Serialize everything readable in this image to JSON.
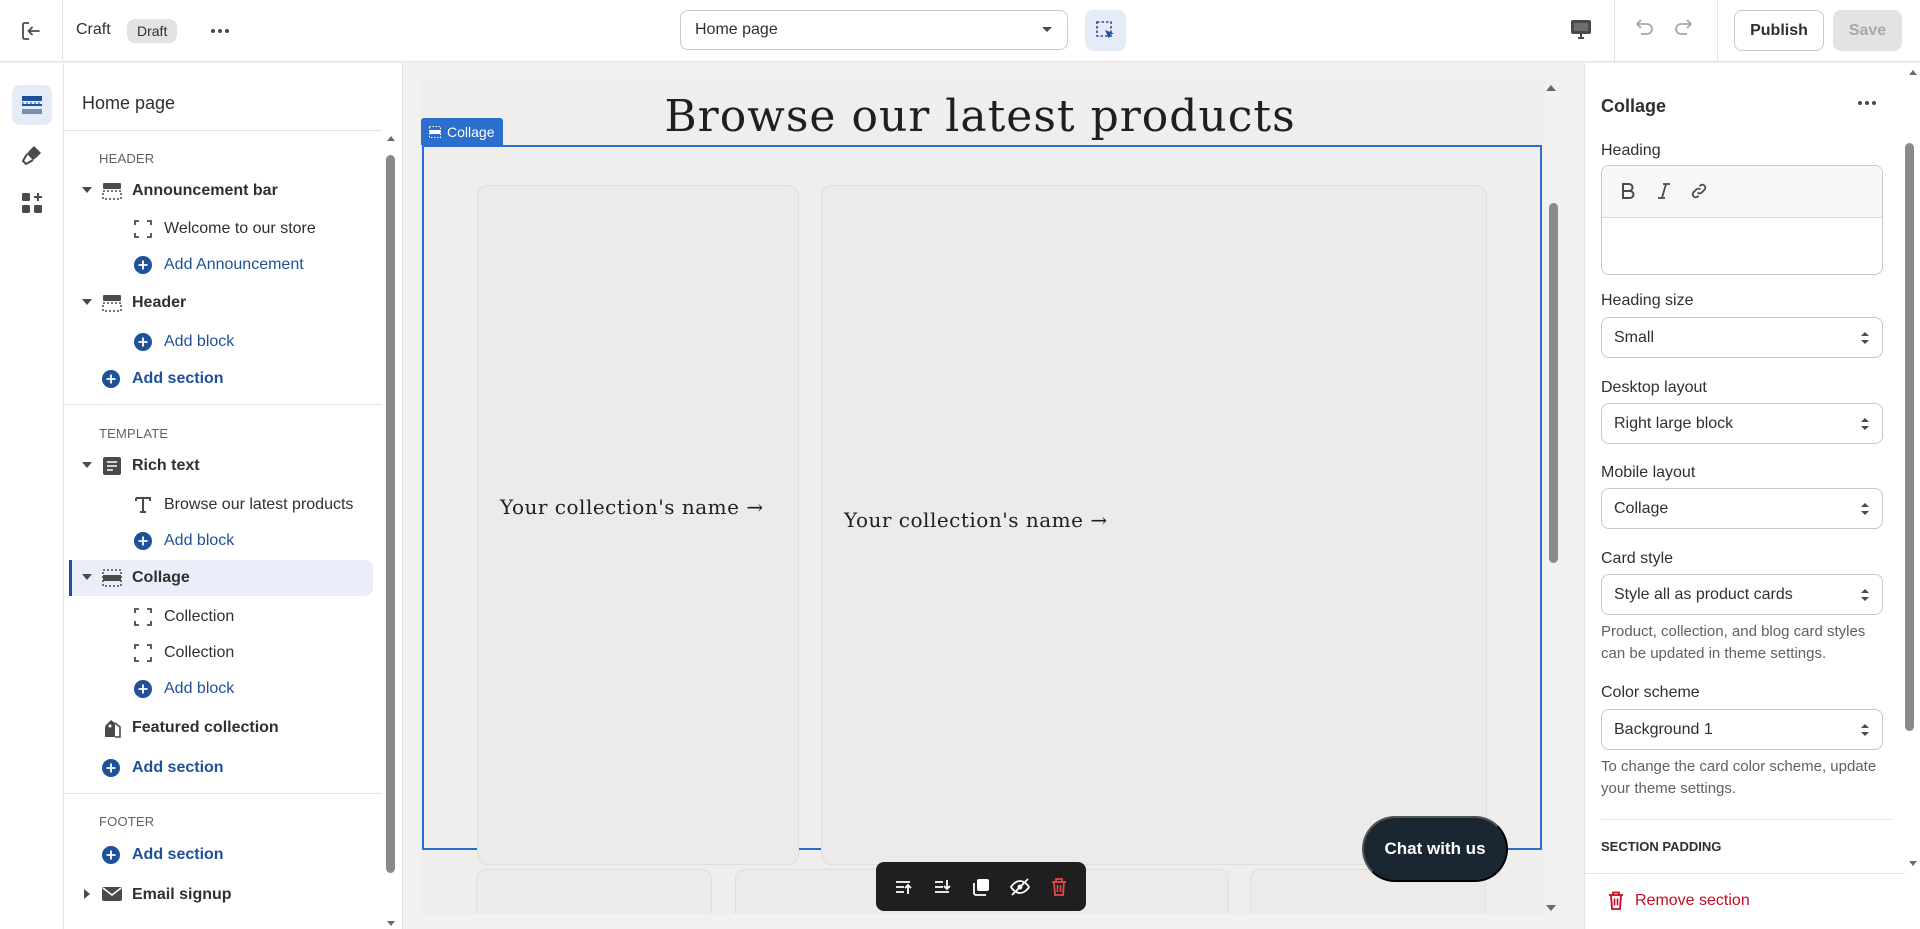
{
  "topbar": {
    "theme_name": "Craft",
    "status_badge": "Draft",
    "page_selector": "Home page",
    "publish_label": "Publish",
    "save_label": "Save"
  },
  "sidebar": {
    "title": "Home page",
    "groups": {
      "header": "HEADER",
      "template": "TEMPLATE",
      "footer": "FOOTER"
    },
    "items": {
      "announcement_bar": "Announcement bar",
      "welcome": "Welcome to our store",
      "add_announcement": "Add Announcement",
      "header": "Header",
      "header_add_block": "Add block",
      "header_add_section": "Add section",
      "rich_text": "Rich text",
      "browse_latest": "Browse our latest products",
      "rich_text_add_block": "Add block",
      "collage": "Collage",
      "collection_1": "Collection",
      "collection_2": "Collection",
      "collage_add_block": "Add block",
      "featured_collection": "Featured collection",
      "template_add_section": "Add section",
      "footer_add_section": "Add section",
      "email_signup": "Email signup"
    }
  },
  "preview": {
    "heading": "Browse our latest products",
    "section_tag": "Collage",
    "card_left_text": "Your collection's name →",
    "card_right_text": "Your collection's name  →",
    "chat_button": "Chat with us"
  },
  "settings": {
    "title": "Collage",
    "heading_label": "Heading",
    "heading_value": "",
    "heading_size_label": "Heading size",
    "heading_size_value": "Small",
    "desktop_layout_label": "Desktop layout",
    "desktop_layout_value": "Right large block",
    "mobile_layout_label": "Mobile layout",
    "mobile_layout_value": "Collage",
    "card_style_label": "Card style",
    "card_style_value": "Style all as product cards",
    "card_style_help": "Product, collection, and blog card styles can be updated in theme settings.",
    "color_scheme_label": "Color scheme",
    "color_scheme_value": "Background 1",
    "color_scheme_help": "To change the card color scheme, update your theme settings.",
    "section_padding_heading": "SECTION PADDING",
    "remove_section_label": "Remove section"
  },
  "colors": {
    "accent": "#2c6ecb",
    "link": "#1f5199",
    "danger": "#c70a24",
    "chat": "#1b2633"
  },
  "icons": [
    "exit-icon",
    "more-horizontal-icon",
    "chevron-down-icon",
    "inspector-icon",
    "desktop-icon",
    "undo-icon",
    "redo-icon",
    "sections-icon",
    "theme-settings-icon",
    "apps-icon",
    "section-icon",
    "block-icon",
    "plus-circle-icon",
    "text-icon",
    "product-tag-icon",
    "email-icon",
    "bold-icon",
    "italic-icon",
    "link-icon",
    "select-arrows-icon",
    "trash-icon",
    "move-up-icon",
    "move-down-icon",
    "duplicate-icon",
    "hide-icon"
  ]
}
